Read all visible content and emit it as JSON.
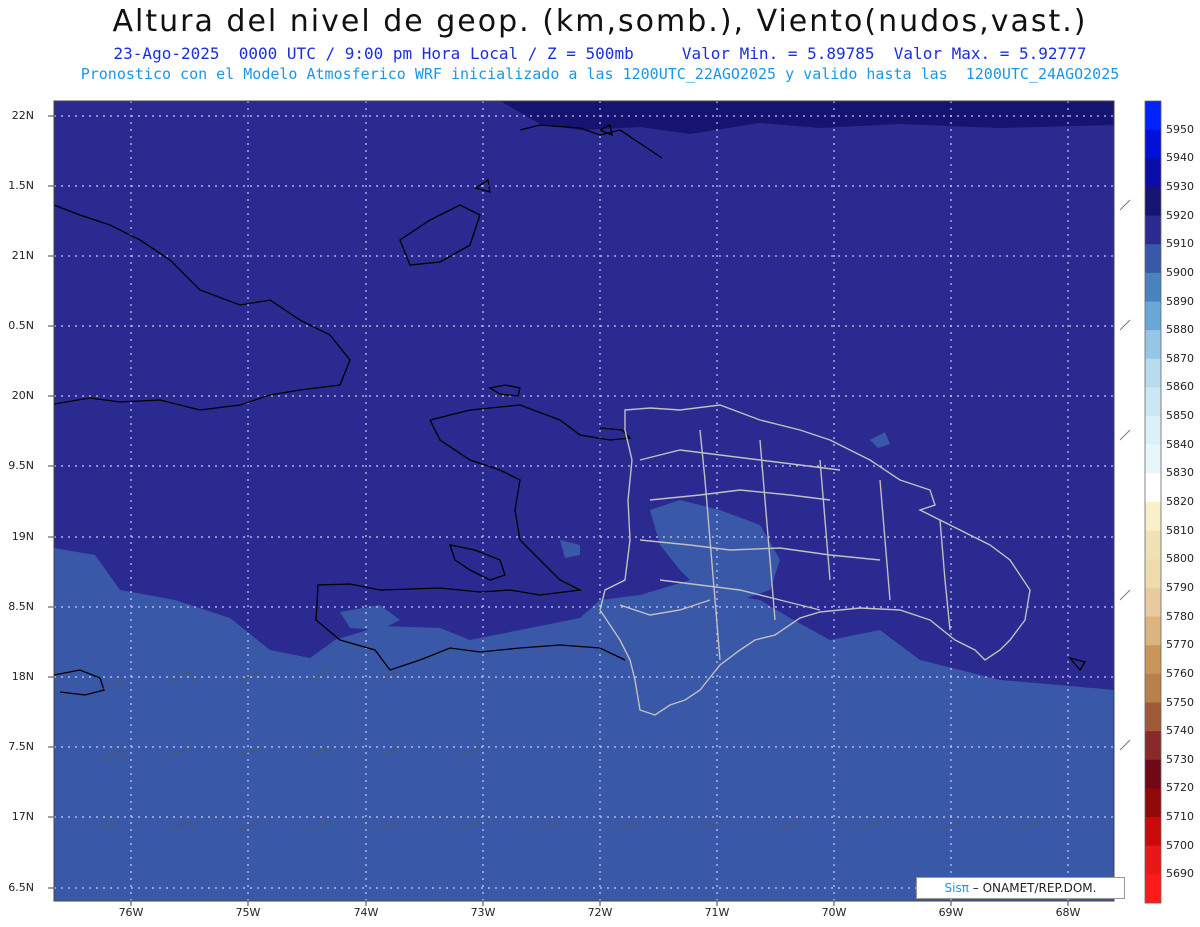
{
  "header": {
    "title": "Altura del nivel de geop. (km,somb.), Viento(nudos,vast.)",
    "subtitle_line1": "23-Ago-2025  0000 UTC / 9:00 pm Hora Local / Z = 500mb     Valor Min. = 5.89785  Valor Max. = 5.92777",
    "subtitle_line2": "Pronostico con el Modelo Atmosferico WRF inicializado a las 1200UTC_22AGO2025 y valido hasta las  1200UTC_24AGO2025"
  },
  "axes": {
    "lat_labels": [
      "22N",
      "1.5N",
      "21N",
      "0.5N",
      "20N",
      "9.5N",
      "19N",
      "8.5N",
      "18N",
      "7.5N",
      "17N",
      "6.5N"
    ],
    "lon_labels": [
      "76W",
      "75W",
      "74W",
      "73W",
      "72W",
      "71W",
      "70W",
      "69W",
      "68W"
    ]
  },
  "colorbar": {
    "labels": [
      "5950",
      "5940",
      "5930",
      "5920",
      "5910",
      "5900",
      "5890",
      "5880",
      "5870",
      "5860",
      "5850",
      "5840",
      "5830",
      "5820",
      "5810",
      "5800",
      "5790",
      "5780",
      "5770",
      "5760",
      "5750",
      "5740",
      "5730",
      "5720",
      "5710",
      "5700",
      "5690"
    ],
    "colors": [
      "#0022ff",
      "#0010d8",
      "#0c0ca8",
      "#161470",
      "#2a2a90",
      "#3a58a8",
      "#4a82c0",
      "#6aa6d6",
      "#96c6e6",
      "#b8dcee",
      "#cce6f4",
      "#dcf0fa",
      "#e8f6fc",
      "#ffffff",
      "#f8f0c8",
      "#f0e2b4",
      "#eedcae",
      "#e8cca0",
      "#dcb482",
      "#c8965a",
      "#b8804a",
      "#a05a38",
      "#882a2a",
      "#700818",
      "#900808",
      "#c80a0a",
      "#e81818",
      "#ff1a1a"
    ]
  },
  "legend_colors": {
    "shade_5910": "#2a2a90",
    "shade_5900": "#3a58a8",
    "shade_5920": "#161470",
    "border_haiti": "#000000",
    "border_dr": "#c0c0c0"
  },
  "credit": {
    "sis": "Sisπ",
    "org": "– ONAMET/REP.DOM."
  }
}
